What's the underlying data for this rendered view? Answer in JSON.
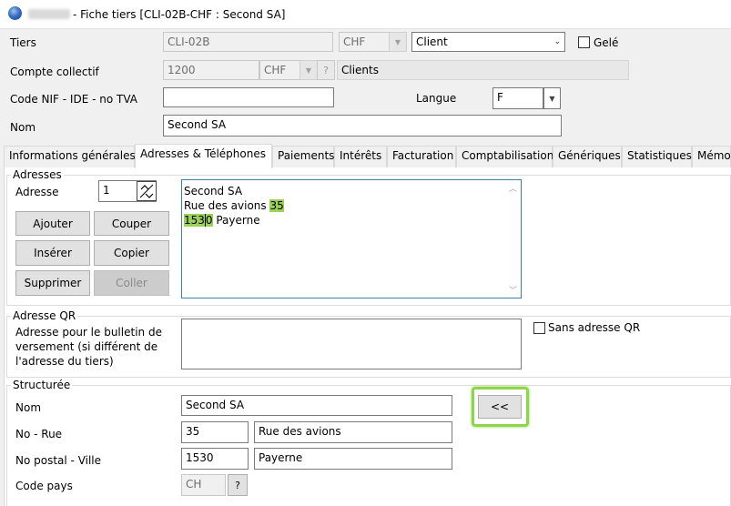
{
  "window": {
    "title": "- Fiche tiers [CLI-02B-CHF : Second SA]"
  },
  "header": {
    "tiers_label": "Tiers",
    "tiers_value": "CLI-02B",
    "tiers_currency": "CHF",
    "tiers_type": "Client",
    "gele_label": "Gelé",
    "compte_label": "Compte collectif",
    "compte_value": "1200",
    "compte_currency": "CHF",
    "compte_help": "?",
    "compte_name": "Clients",
    "nif_label": "Code NIF - IDE - no TVA",
    "nif_value": "",
    "langue_label": "Langue",
    "langue_value": "F",
    "nom_label": "Nom",
    "nom_value": "Second SA"
  },
  "tabs": [
    {
      "label": "Informations générales"
    },
    {
      "label": "Adresses & Téléphones"
    },
    {
      "label": "Paiements"
    },
    {
      "label": "Intérêts"
    },
    {
      "label": "Facturation"
    },
    {
      "label": "Comptabilisation"
    },
    {
      "label": "Génériques"
    },
    {
      "label": "Statistiques"
    },
    {
      "label": "Mémo"
    }
  ],
  "adresses": {
    "group_title": "Adresses",
    "adresse_label": "Adresse",
    "adresse_number": "1",
    "buttons": {
      "ajouter": "Ajouter",
      "couper": "Couper",
      "inserer": "Insérer",
      "copier": "Copier",
      "supprimer": "Supprimer",
      "coller": "Coller"
    },
    "lines": {
      "line1": "Second SA",
      "line2_prefix": "Rue des avions ",
      "line2_number": "35",
      "line3_zip_a": "153",
      "line3_zip_b": "0",
      "line3_city": " Payerne"
    }
  },
  "qr": {
    "group_title": "Adresse QR",
    "description": "Adresse pour le bulletin de versement (si différent de l'adresse du tiers)",
    "sans_label": "Sans adresse QR",
    "value": ""
  },
  "structuree": {
    "group_title": "Structurée",
    "nom_label": "Nom",
    "nom_value": "Second SA",
    "no_rue_label": "No - Rue",
    "no_value": "35",
    "rue_value": "Rue des avions",
    "postal_label": "No postal - Ville",
    "postal_value": "1530",
    "ville_value": "Payerne",
    "pays_label": "Code pays",
    "pays_value": "CH",
    "pays_help": "?",
    "copy_button": "<<"
  },
  "colors": {
    "highlight": "#9bd05b",
    "focus_ring": "#8ed44c",
    "active_border": "#3c7fb1"
  }
}
